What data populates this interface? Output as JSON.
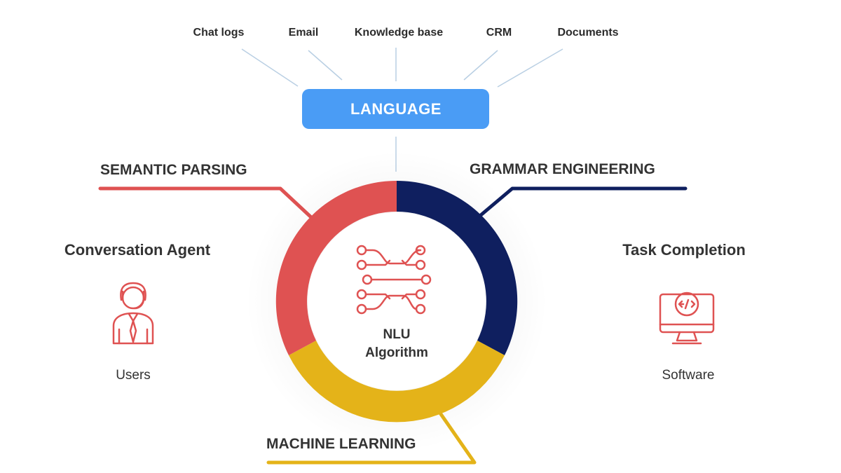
{
  "sources": [
    "Chat logs",
    "Email",
    "Knowledge base",
    "CRM",
    "Documents"
  ],
  "language_label": "LANGUAGE",
  "segments": {
    "semantic_parsing": "SEMANTIC PARSING",
    "grammar_engineering": "GRAMMAR ENGINEERING",
    "machine_learning": "MACHINE LEARNING"
  },
  "center": {
    "line1": "NLU",
    "line2": "Algorithm",
    "icon": "neural-network-icon"
  },
  "left_panel": {
    "title": "Conversation Agent",
    "subtitle": "Users",
    "icon": "user-agent-icon"
  },
  "right_panel": {
    "title": "Task Completion",
    "subtitle": "Software",
    "icon": "software-monitor-icon"
  },
  "colors": {
    "language_box": "#4a9cf5",
    "semantic": "#df5252",
    "grammar": "#0f1f5f",
    "machine": "#e4b319",
    "icon": "#df5252",
    "connector": "#b9cfe3"
  }
}
